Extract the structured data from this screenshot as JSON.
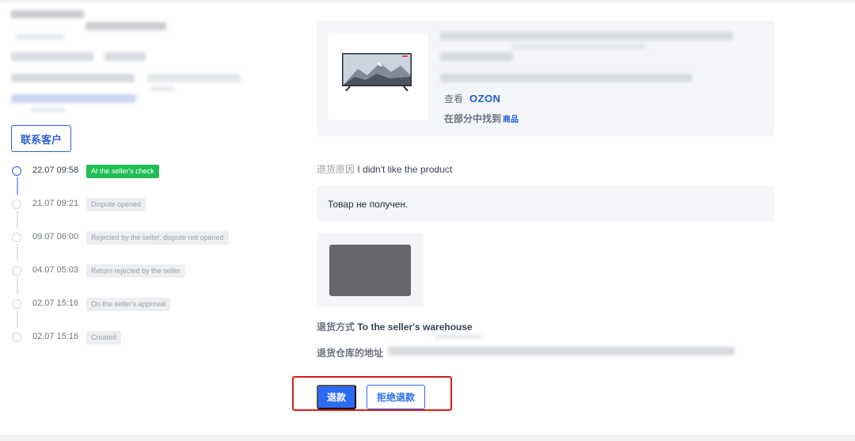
{
  "left": {
    "contact_button": "联系客户",
    "timeline": [
      {
        "time": "22.07 09:58",
        "status": "At the seller's check",
        "active": true
      },
      {
        "time": "21.07 09:21",
        "status": "Dispute opened",
        "active": false
      },
      {
        "time": "09.07 06:00",
        "status": "Rejected by the seller, dispute not opened",
        "active": false
      },
      {
        "time": "04.07 05:03",
        "status": "Return rejected by the seller",
        "active": false
      },
      {
        "time": "02.07 15:16",
        "status": "On the seller's approval",
        "active": false
      },
      {
        "time": "02.07 15:16",
        "status": "Created",
        "active": false
      }
    ]
  },
  "product": {
    "view_label": "查看",
    "ozon_label": "OZON",
    "find_label": "在部分中找到",
    "find_link": "商品"
  },
  "return": {
    "reason_label": "退货原因",
    "reason_value": "I didn't like the product",
    "comment": "Товар не получен.",
    "method_label": "退货方式",
    "method_value": "To the seller's warehouse",
    "warehouse_label": "退货仓库的地址"
  },
  "actions": {
    "refund": "退款",
    "reject_refund": "拒绝退款"
  },
  "colors": {
    "accent": "#2a6bf2",
    "status_green": "#1fbf55",
    "highlight_red": "#d81c1c"
  }
}
